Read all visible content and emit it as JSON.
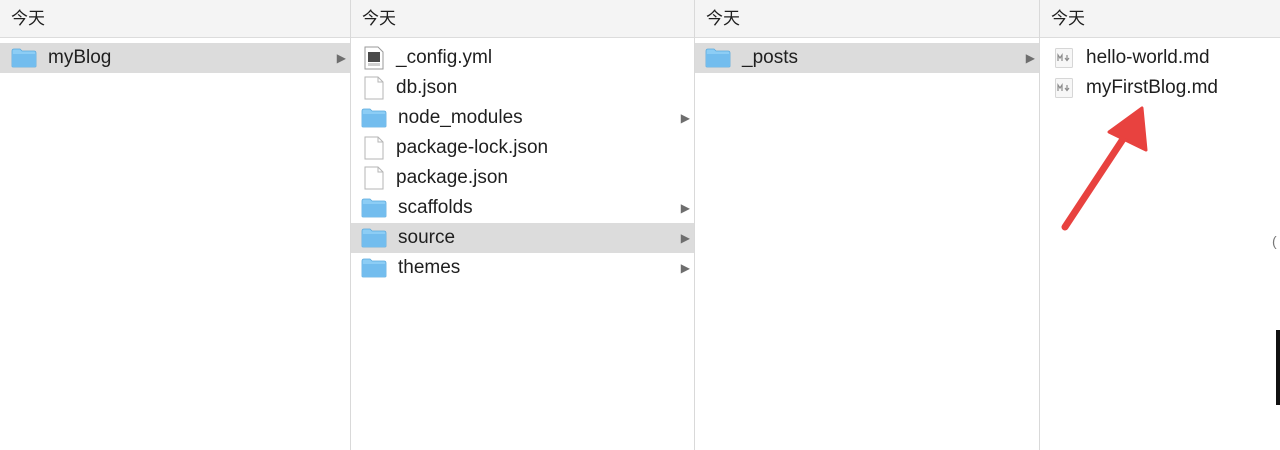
{
  "columns": [
    {
      "header": "今天",
      "items": [
        {
          "label": "myBlog",
          "icon": "folder-icon",
          "selected": true,
          "has_children": true
        }
      ]
    },
    {
      "header": "今天",
      "items": [
        {
          "label": "_config.yml",
          "icon": "yaml-file-icon",
          "selected": false,
          "has_children": false
        },
        {
          "label": "db.json",
          "icon": "document-icon",
          "selected": false,
          "has_children": false
        },
        {
          "label": "node_modules",
          "icon": "folder-icon",
          "selected": false,
          "has_children": true
        },
        {
          "label": "package-lock.json",
          "icon": "document-icon",
          "selected": false,
          "has_children": false
        },
        {
          "label": "package.json",
          "icon": "document-icon",
          "selected": false,
          "has_children": false
        },
        {
          "label": "scaffolds",
          "icon": "folder-icon",
          "selected": false,
          "has_children": true
        },
        {
          "label": "source",
          "icon": "folder-icon",
          "selected": true,
          "has_children": true
        },
        {
          "label": "themes",
          "icon": "folder-icon",
          "selected": false,
          "has_children": true
        }
      ]
    },
    {
      "header": "今天",
      "items": [
        {
          "label": "_posts",
          "icon": "folder-icon",
          "selected": true,
          "has_children": true
        }
      ]
    },
    {
      "header": "今天",
      "items": [
        {
          "label": "hello-world.md",
          "icon": "markdown-file-icon",
          "selected": false,
          "has_children": false
        },
        {
          "label": "myFirstBlog.md",
          "icon": "markdown-file-icon",
          "selected": false,
          "has_children": false
        }
      ]
    }
  ],
  "annotation": {
    "icon": "red-arrow-icon",
    "color": "#e8423f"
  },
  "colors": {
    "selected_bg": "#dcdcdc",
    "folder": "#7cc4f2",
    "header_bg": "#f4f4f4"
  }
}
